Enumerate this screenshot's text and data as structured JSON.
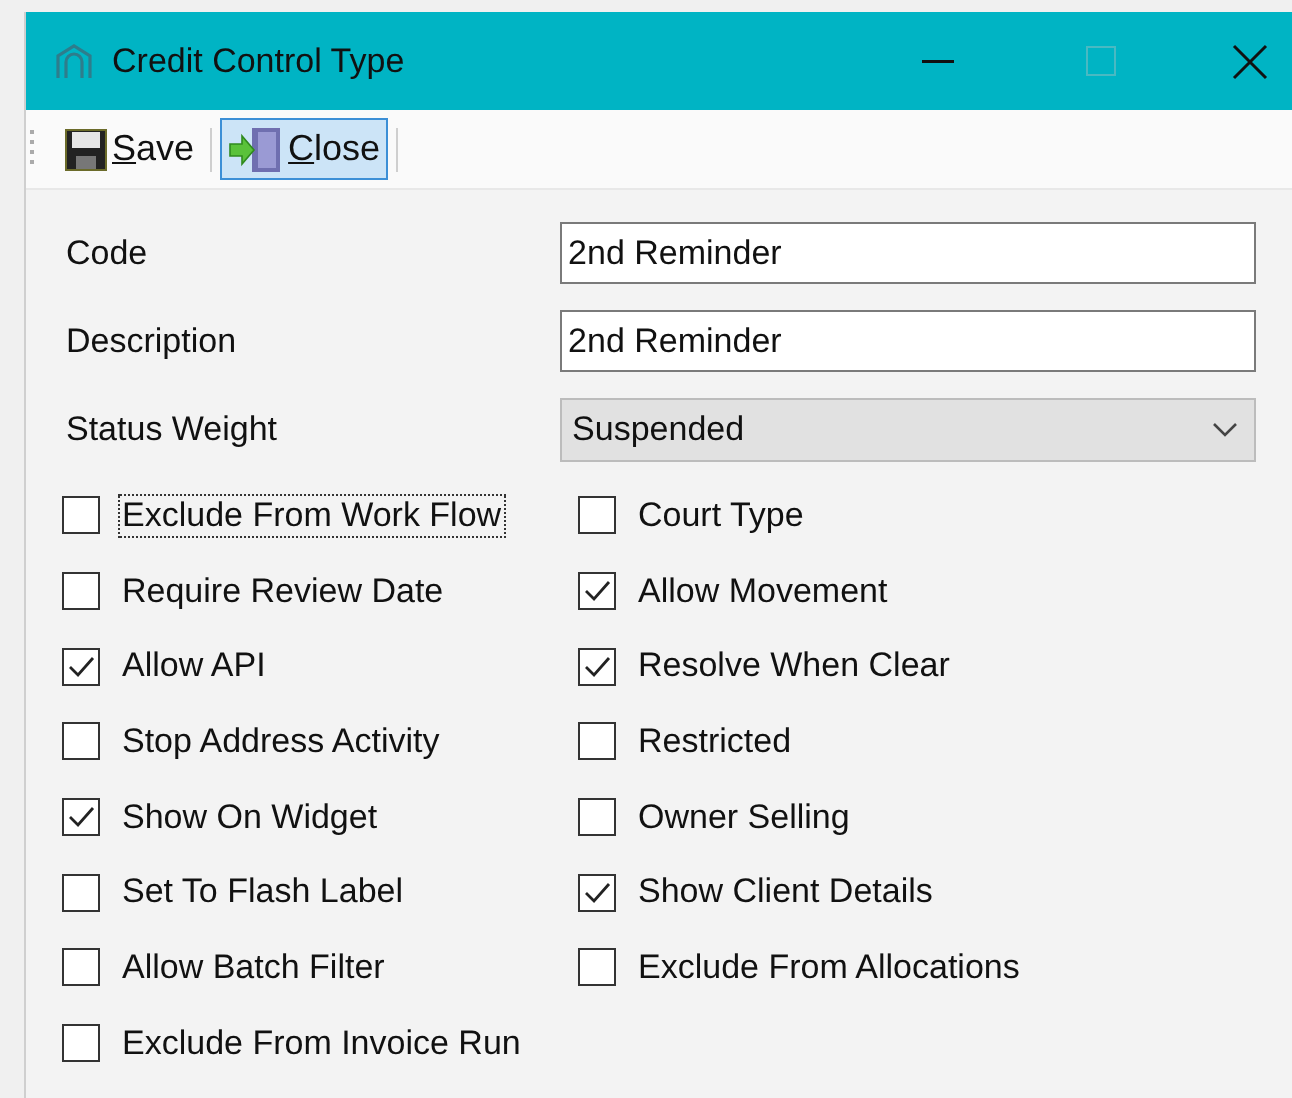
{
  "window": {
    "title": "Credit Control Type"
  },
  "toolbar": [
    {
      "label": "Save",
      "first_letter_underlined": true,
      "kind": "save",
      "selected": false
    },
    {
      "label": "Close",
      "first_letter_underlined": true,
      "kind": "close",
      "selected": true
    }
  ],
  "fields": [
    {
      "label": "Code",
      "value": "2nd Reminder",
      "kind": "text"
    },
    {
      "label": "Description",
      "value": "2nd Reminder",
      "kind": "text"
    },
    {
      "label": "Status Weight",
      "value": "Suspended",
      "kind": "dropdown"
    }
  ],
  "left_checkboxes": [
    {
      "label": "Exclude From Work Flow",
      "checked": false,
      "focused": true
    },
    {
      "label": "Require Review Date",
      "checked": false,
      "focused": false
    },
    {
      "label": "Allow API",
      "checked": true,
      "focused": false
    },
    {
      "label": "Stop Address Activity",
      "checked": false,
      "focused": false
    },
    {
      "label": "Show On Widget",
      "checked": true,
      "focused": false
    },
    {
      "label": "Set To Flash Label",
      "checked": false,
      "focused": false
    },
    {
      "label": "Allow Batch Filter",
      "checked": false,
      "focused": false
    },
    {
      "label": "Exclude From Invoice Run",
      "checked": false,
      "focused": false
    }
  ],
  "right_checkboxes": [
    {
      "label": "Court Type",
      "checked": false,
      "focused": false
    },
    {
      "label": "Allow Movement",
      "checked": true,
      "focused": false
    },
    {
      "label": "Resolve When Clear",
      "checked": true,
      "focused": false
    },
    {
      "label": "Restricted",
      "checked": false,
      "focused": false
    },
    {
      "label": "Owner Selling",
      "checked": false,
      "focused": false
    },
    {
      "label": "Show Client Details",
      "checked": true,
      "focused": false
    },
    {
      "label": "Exclude From Allocations",
      "checked": false,
      "focused": false
    }
  ]
}
